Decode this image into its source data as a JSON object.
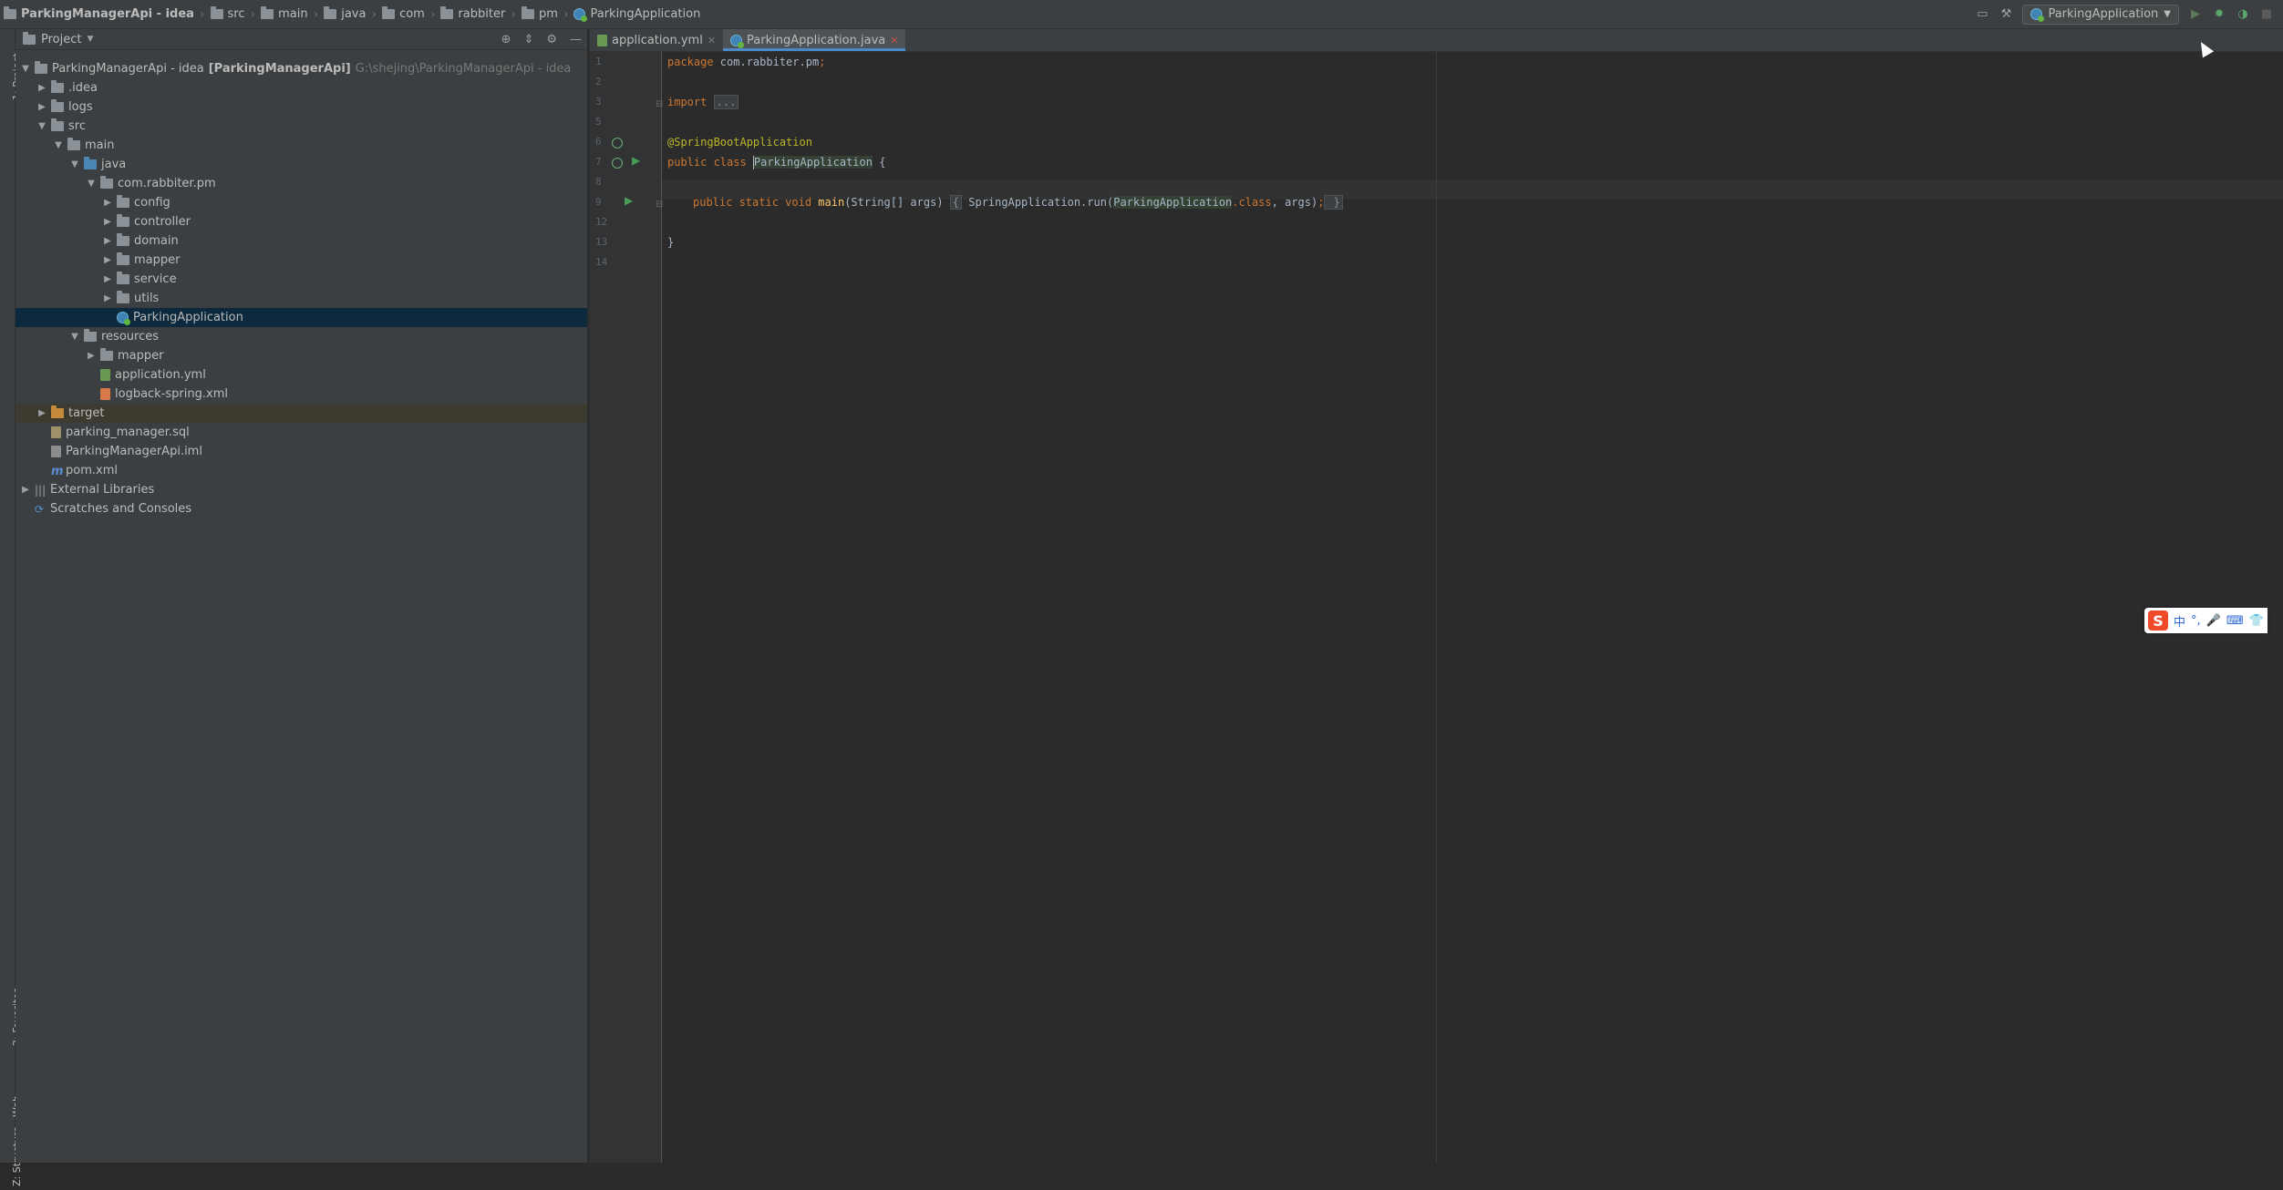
{
  "navbar": {
    "crumbs": [
      {
        "label": "ParkingManagerApi - idea",
        "icon": "folder-icon"
      },
      {
        "label": "src",
        "icon": "folder-icon"
      },
      {
        "label": "main",
        "icon": "folder-icon"
      },
      {
        "label": "java",
        "icon": "folder-icon"
      },
      {
        "label": "com",
        "icon": "folder-icon"
      },
      {
        "label": "rabbiter",
        "icon": "folder-icon"
      },
      {
        "label": "pm",
        "icon": "folder-icon"
      },
      {
        "label": "ParkingApplication",
        "icon": "spring-class-icon"
      }
    ],
    "run_config": "ParkingApplication"
  },
  "left_strip": {
    "project": "1: Project",
    "favorites": "2: Favorites",
    "web": "Web",
    "structure": "Z: Structure"
  },
  "project_panel": {
    "title": "Project",
    "tree": [
      {
        "label": "ParkingManagerApi - idea",
        "bold_suffix": "[ParkingManagerApi]",
        "path": "G:\\shejing\\ParkingManagerApi - idea",
        "indent": 0,
        "arrow": "down",
        "icon": "module-folder"
      },
      {
        "label": ".idea",
        "indent": 1,
        "arrow": "right",
        "icon": "folder"
      },
      {
        "label": "logs",
        "indent": 1,
        "arrow": "right",
        "icon": "folder"
      },
      {
        "label": "src",
        "indent": 1,
        "arrow": "down",
        "icon": "folder"
      },
      {
        "label": "main",
        "indent": 2,
        "arrow": "down",
        "icon": "folder"
      },
      {
        "label": "java",
        "indent": 3,
        "arrow": "down",
        "icon": "source-folder"
      },
      {
        "label": "com.rabbiter.pm",
        "indent": 4,
        "arrow": "down",
        "icon": "package"
      },
      {
        "label": "config",
        "indent": 5,
        "arrow": "right",
        "icon": "package"
      },
      {
        "label": "controller",
        "indent": 5,
        "arrow": "right",
        "icon": "package"
      },
      {
        "label": "domain",
        "indent": 5,
        "arrow": "right",
        "icon": "package"
      },
      {
        "label": "mapper",
        "indent": 5,
        "arrow": "right",
        "icon": "package"
      },
      {
        "label": "service",
        "indent": 5,
        "arrow": "right",
        "icon": "package"
      },
      {
        "label": "utils",
        "indent": 5,
        "arrow": "right",
        "icon": "package"
      },
      {
        "label": "ParkingApplication",
        "indent": 5,
        "arrow": "none",
        "icon": "spring-class",
        "selected": true
      },
      {
        "label": "resources",
        "indent": 3,
        "arrow": "down",
        "icon": "resources-folder"
      },
      {
        "label": "mapper",
        "indent": 4,
        "arrow": "right",
        "icon": "folder"
      },
      {
        "label": "application.yml",
        "indent": 4,
        "arrow": "none",
        "icon": "yml-file"
      },
      {
        "label": "logback-spring.xml",
        "indent": 4,
        "arrow": "none",
        "icon": "xml-file"
      },
      {
        "label": "target",
        "indent": 1,
        "arrow": "right",
        "icon": "excluded-folder",
        "excluded": true
      },
      {
        "label": "parking_manager.sql",
        "indent": 1,
        "arrow": "none",
        "icon": "sql-file"
      },
      {
        "label": "ParkingManagerApi.iml",
        "indent": 1,
        "arrow": "none",
        "icon": "iml-file"
      },
      {
        "label": "pom.xml",
        "indent": 1,
        "arrow": "none",
        "icon": "maven-file"
      },
      {
        "label": "External Libraries",
        "indent": 0,
        "arrow": "right",
        "icon": "library"
      },
      {
        "label": "Scratches and Consoles",
        "indent": 0,
        "arrow": "none",
        "icon": "scratch"
      }
    ]
  },
  "editor": {
    "tabs": [
      {
        "label": "application.yml",
        "active": false,
        "icon": "yml-file"
      },
      {
        "label": "ParkingApplication.java",
        "active": true,
        "icon": "spring-class"
      }
    ],
    "line_numbers": [
      "1",
      "2",
      "3",
      "5",
      "6",
      "7",
      "8",
      "9",
      "12",
      "13",
      "14"
    ],
    "code": {
      "l1_kw": "package",
      "l1_rest": " com.rabbiter.pm",
      "l1_semi": ";",
      "l3_kw": "import",
      "l3_fold": "...",
      "l6_ann": "@SpringBootApplication",
      "l7_kw": "public class ",
      "l7_name": "ParkingApplication",
      "l7_rest": " {",
      "l9_kw": "public static void ",
      "l9_fn": "main",
      "l9_args": "(String[] args) ",
      "l9_fold_open": "{",
      "l9_body1": " SpringApplication.",
      "l9_call": "run",
      "l9_body2": "(",
      "l9_cls": "ParkingApplication",
      "l9_dotclass": ".class",
      "l9_comma": ", args)",
      "l9_semi": ";",
      "l9_fold_close": " }",
      "l13": "}"
    }
  },
  "ime": {
    "logo": "S",
    "items": [
      "中",
      "°,",
      "🎤",
      "⌨",
      "👕"
    ]
  }
}
